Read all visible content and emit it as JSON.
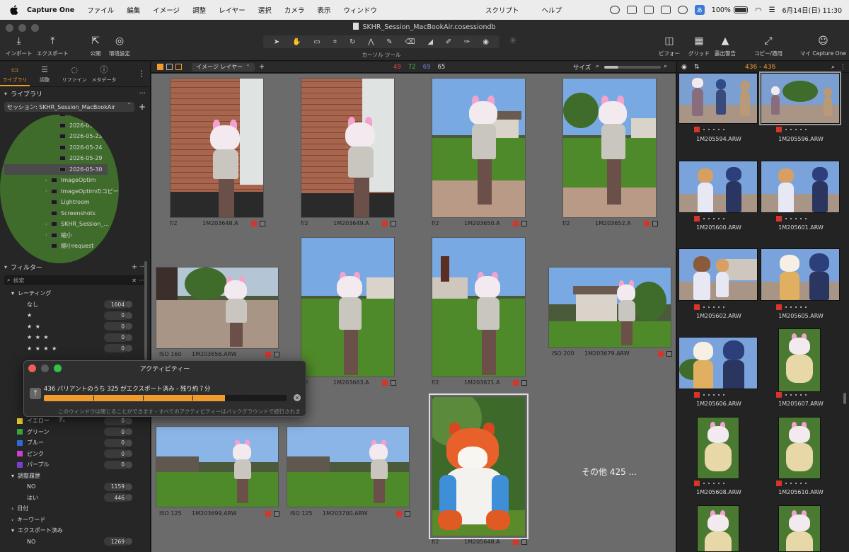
{
  "menubar": {
    "app_name": "Capture One",
    "items": [
      "ファイル",
      "編集",
      "イメージ",
      "調整",
      "レイヤー",
      "選択",
      "カメラ",
      "表示",
      "ウィンドウ"
    ],
    "center_items": [
      "スクリプト",
      "ヘルプ"
    ],
    "ime": "あ",
    "battery": "100%",
    "datetime": "6月14日(日) 11:30"
  },
  "window": {
    "title": "SKHR_Session_MacBookAir.cosessiondb"
  },
  "toolbar": {
    "left_tools": [
      {
        "label": "インポート",
        "icon": "import-icon"
      },
      {
        "label": "エクスポート",
        "icon": "export-icon"
      },
      {
        "label": "公開",
        "icon": "publish-icon"
      },
      {
        "label": "環境設定",
        "icon": "preferences-icon"
      }
    ],
    "cursor_tools_label": "カーソル ツール",
    "right_tools": [
      {
        "label": "ビフォー",
        "icon": "before-after-icon"
      },
      {
        "label": "グリッド",
        "icon": "grid-icon"
      },
      {
        "label": "露出警告",
        "icon": "exposure-warning-icon"
      },
      {
        "label": "コピー/適用",
        "icon": "copy-apply-icon"
      },
      {
        "label": "マイ Capture One",
        "icon": "account-icon"
      }
    ]
  },
  "left_tabs": [
    {
      "label": "ライブラリ",
      "icon": "library-icon",
      "active": true
    },
    {
      "label": "調整",
      "icon": "adjust-icon",
      "active": false
    },
    {
      "label": "リファイン",
      "icon": "refine-icon",
      "active": false
    },
    {
      "label": "メタデータ",
      "icon": "metadata-icon",
      "active": false
    }
  ],
  "library": {
    "header": "ライブラリ",
    "session": "セッション: SKHR_Session_MacBookAir",
    "tree": [
      {
        "label": "2026-05-17",
        "type": "date"
      },
      {
        "label": "2026-05-22",
        "type": "date"
      },
      {
        "label": "2026-05-23",
        "type": "date"
      },
      {
        "label": "2026-05-24",
        "type": "date"
      },
      {
        "label": "2026-05-29",
        "type": "date"
      },
      {
        "label": "2026-05-30",
        "type": "date",
        "selected": true
      },
      {
        "label": "ImageOptim",
        "type": "folder",
        "expand": true
      },
      {
        "label": "ImageOptimのコピー",
        "type": "folder",
        "expand": true
      },
      {
        "label": "Lightroom",
        "type": "folder"
      },
      {
        "label": "Screenshots",
        "type": "folder"
      },
      {
        "label": "SKHR_Session_...",
        "type": "folder",
        "expand": true,
        "favorite": true
      },
      {
        "label": "縮小",
        "type": "folder",
        "expand": true
      },
      {
        "label": "縮小request",
        "type": "folder"
      }
    ]
  },
  "filters": {
    "header": "フィルター",
    "search_placeholder": "検索",
    "rating_header": "レーティング",
    "ratings": [
      {
        "label": "なし",
        "count": "1604"
      },
      {
        "label": "★",
        "count": "0"
      },
      {
        "label": "★ ★",
        "count": "0"
      },
      {
        "label": "★ ★ ★",
        "count": "0"
      },
      {
        "label": "★ ★ ★ ★",
        "count": "0"
      }
    ],
    "colors": [
      {
        "label": "イエロー",
        "count": "0",
        "color": "#e6c72a"
      },
      {
        "label": "グリーン",
        "count": "0",
        "color": "#3aa63a"
      },
      {
        "label": "ブルー",
        "count": "0",
        "color": "#2f6bd6"
      },
      {
        "label": "ピンク",
        "count": "0",
        "color": "#cf3fcf"
      },
      {
        "label": "パープル",
        "count": "0",
        "color": "#7a3fc9"
      }
    ],
    "history_header": "調整履歴",
    "history": [
      {
        "label": "NO",
        "count": "1159"
      },
      {
        "label": "はい",
        "count": "446"
      }
    ],
    "date_header": "日付",
    "keyword_header": "キーワード",
    "exported_header": "エクスポート済み",
    "exported": [
      {
        "label": "NO",
        "count": "1269"
      }
    ]
  },
  "viewer_bar": {
    "layer_select": "イメージ レイヤー",
    "counts": [
      {
        "value": "49",
        "color": "#e8473c"
      },
      {
        "value": "72",
        "color": "#3fb24a"
      },
      {
        "value": "69",
        "color": "#6f7de6"
      },
      {
        "value": "65",
        "color": "#d8d8d8"
      }
    ],
    "size_label": "サイズ"
  },
  "browser": {
    "thumbnails": [
      {
        "iso": "f/2",
        "name": "1M203648.A"
      },
      {
        "iso": "f/2",
        "name": "1M203649.A"
      },
      {
        "iso": "f/2",
        "name": "1M203650.A"
      },
      {
        "iso": "f/2",
        "name": "1M203652.A"
      },
      {
        "iso": "ISO 160",
        "name": "1M203656.ARW"
      },
      {
        "iso": "f/2",
        "name": "1M203663.A"
      },
      {
        "iso": "f/2",
        "name": "1M203671.A"
      },
      {
        "iso": "ISO 200",
        "name": "1M203679.ARW"
      },
      {
        "iso": "ISO 125",
        "name": "1M203699.ARW"
      },
      {
        "iso": "ISO 125",
        "name": "1M203700.ARW"
      },
      {
        "iso": "f/2",
        "name": "1M205648.A"
      }
    ],
    "more_text": "その他 425 ..."
  },
  "activity": {
    "title": "アクティビティー",
    "message": "436 バリアントのうち 325 がエクスポート済み - 残り約７分",
    "progress": 0.745,
    "note": "このウィンドウは閉じることができます - すべてのアクティビティーはバックグラウンドで続行されます。"
  },
  "filmstrip": {
    "range": "436 - 436",
    "items": [
      {
        "name": "1M205594.ARW"
      },
      {
        "name": "1M205596.ARW"
      },
      {
        "name": "1M205600.ARW"
      },
      {
        "name": "1M205601.ARW"
      },
      {
        "name": "1M205602.ARW"
      },
      {
        "name": "1M205605.ARW"
      },
      {
        "name": "1M205606.ARW"
      },
      {
        "name": "1M205607.ARW"
      },
      {
        "name": "1M205608.ARW"
      },
      {
        "name": "1M205610.ARW"
      }
    ]
  }
}
